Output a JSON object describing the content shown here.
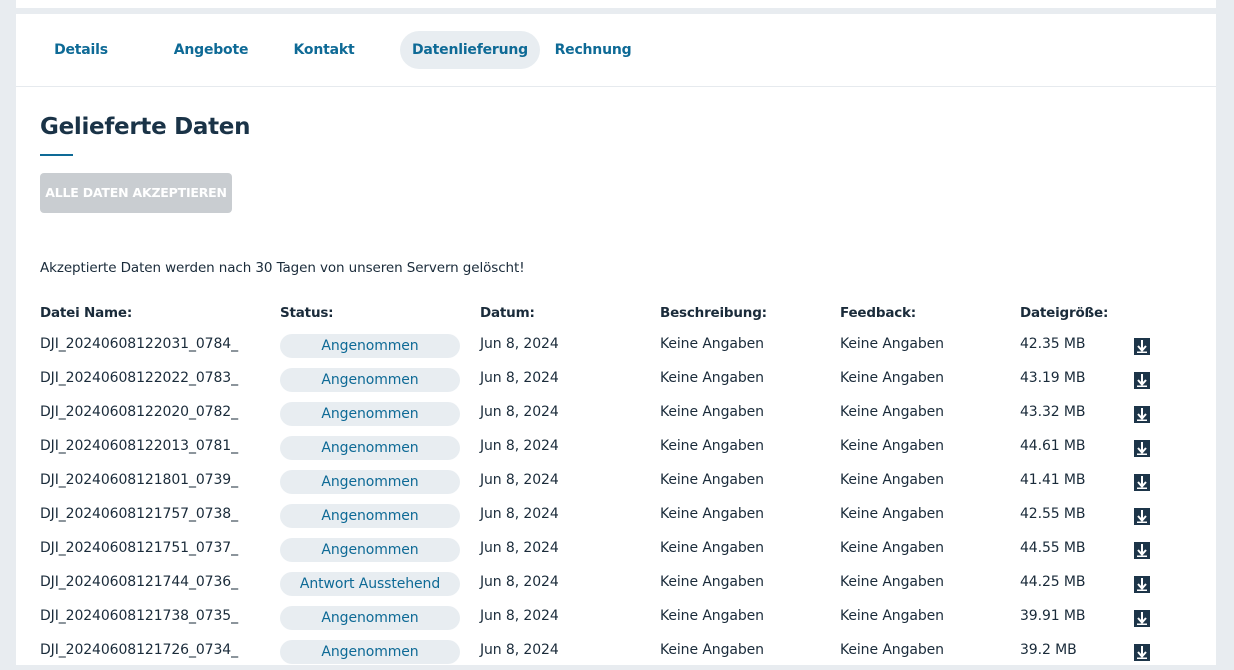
{
  "tabs": [
    {
      "label": "Details",
      "active": false
    },
    {
      "label": "Angebote",
      "active": false
    },
    {
      "label": "Kontakt",
      "active": false
    },
    {
      "label": "Datenlieferung",
      "active": true
    },
    {
      "label": "Rechnung",
      "active": false
    }
  ],
  "page": {
    "title": "Gelieferte Daten",
    "accept_all_label": "ALLE DATEN AKZEPTIEREN",
    "notice": "Akzeptierte Daten werden nach 30 Tagen von unseren Servern gelöscht!"
  },
  "table": {
    "headers": {
      "name": "Datei Name:",
      "status": "Status:",
      "date": "Datum:",
      "description": "Beschreibung:",
      "feedback": "Feedback:",
      "size": "Dateigröße:"
    },
    "rows": [
      {
        "name": "DJI_20240608122031_0784_",
        "status": "Angenommen",
        "date": "Jun 8, 2024",
        "description": "Keine Angaben",
        "feedback": "Keine Angaben",
        "size": "42.35 MB"
      },
      {
        "name": "DJI_20240608122022_0783_",
        "status": "Angenommen",
        "date": "Jun 8, 2024",
        "description": "Keine Angaben",
        "feedback": "Keine Angaben",
        "size": "43.19 MB"
      },
      {
        "name": "DJI_20240608122020_0782_",
        "status": "Angenommen",
        "date": "Jun 8, 2024",
        "description": "Keine Angaben",
        "feedback": "Keine Angaben",
        "size": "43.32 MB"
      },
      {
        "name": "DJI_20240608122013_0781_",
        "status": "Angenommen",
        "date": "Jun 8, 2024",
        "description": "Keine Angaben",
        "feedback": "Keine Angaben",
        "size": "44.61 MB"
      },
      {
        "name": "DJI_20240608121801_0739_",
        "status": "Angenommen",
        "date": "Jun 8, 2024",
        "description": "Keine Angaben",
        "feedback": "Keine Angaben",
        "size": "41.41 MB"
      },
      {
        "name": "DJI_20240608121757_0738_",
        "status": "Angenommen",
        "date": "Jun 8, 2024",
        "description": "Keine Angaben",
        "feedback": "Keine Angaben",
        "size": "42.55 MB"
      },
      {
        "name": "DJI_20240608121751_0737_",
        "status": "Angenommen",
        "date": "Jun 8, 2024",
        "description": "Keine Angaben",
        "feedback": "Keine Angaben",
        "size": "44.55 MB"
      },
      {
        "name": "DJI_20240608121744_0736_",
        "status": "Antwort Ausstehend",
        "date": "Jun 8, 2024",
        "description": "Keine Angaben",
        "feedback": "Keine Angaben",
        "size": "44.25 MB"
      },
      {
        "name": "DJI_20240608121738_0735_",
        "status": "Angenommen",
        "date": "Jun 8, 2024",
        "description": "Keine Angaben",
        "feedback": "Keine Angaben",
        "size": "39.91 MB"
      },
      {
        "name": "DJI_20240608121726_0734_",
        "status": "Angenommen",
        "date": "Jun 8, 2024",
        "description": "Keine Angaben",
        "feedback": "Keine Angaben",
        "size": "39.2 MB"
      }
    ]
  },
  "icons": {
    "download": "download-icon"
  },
  "colors": {
    "accent": "#0e6a96",
    "heading": "#1a3347",
    "badge_bg": "#e8edf1",
    "disabled_button": "#c9cdd1",
    "page_bg": "#e8ecf0"
  }
}
